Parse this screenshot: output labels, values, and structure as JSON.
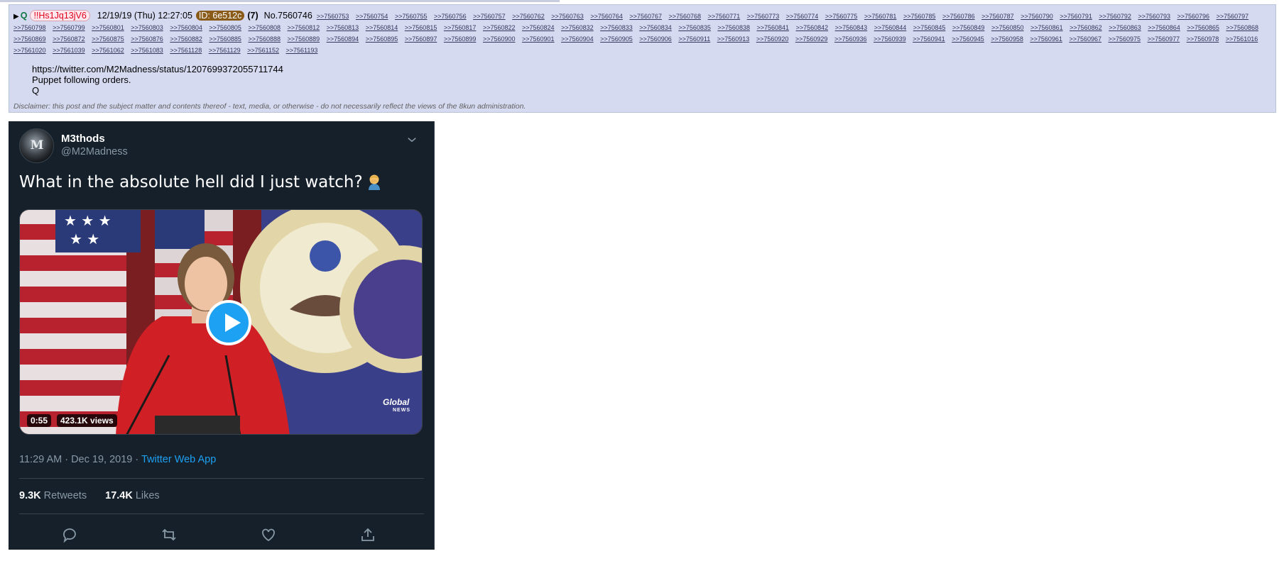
{
  "post": {
    "triangle": "▶",
    "name": "Q",
    "tripcode": "!!Hs1Jq13jV6",
    "datetime": "12/19/19 (Thu) 12:27:05",
    "id_badge": "ID: 6e512c",
    "id_count": "(7)",
    "post_number": "No.7560746",
    "replies": [
      ">>7560753",
      ">>7560754",
      ">>7560755",
      ">>7560756",
      ">>7560757",
      ">>7560762",
      ">>7560763",
      ">>7560764",
      ">>7560767",
      ">>7560768",
      ">>7560771",
      ">>7560773",
      ">>7560774",
      ">>7560775",
      ">>7560781",
      ">>7560785",
      ">>7560786",
      ">>7560787",
      ">>7560790",
      ">>7560791",
      ">>7560792",
      ">>7560793",
      ">>7560796",
      ">>7560797",
      ">>7560798",
      ">>7560799",
      ">>7560801",
      ">>7560803",
      ">>7560804",
      ">>7560805",
      ">>7560808",
      ">>7560812",
      ">>7560813",
      ">>7560814",
      ">>7560815",
      ">>7560817",
      ">>7560822",
      ">>7560824",
      ">>7560832",
      ">>7560833",
      ">>7560834",
      ">>7560835",
      ">>7560838",
      ">>7560841",
      ">>7560842",
      ">>7560843",
      ">>7560844",
      ">>7560845",
      ">>7560849",
      ">>7560850",
      ">>7560861",
      ">>7560862",
      ">>7560863",
      ">>7560864",
      ">>7560865",
      ">>7560868",
      ">>7560869",
      ">>7560872",
      ">>7560875",
      ">>7560876",
      ">>7560882",
      ">>7560885",
      ">>7560888",
      ">>7560889",
      ">>7560894",
      ">>7560895",
      ">>7560897",
      ">>7560899",
      ">>7560900",
      ">>7560901",
      ">>7560904",
      ">>7560905",
      ">>7560906",
      ">>7560911",
      ">>7560913",
      ">>7560920",
      ">>7560929",
      ">>7560936",
      ">>7560939",
      ">>7560941",
      ">>7560945",
      ">>7560958",
      ">>7560961",
      ">>7560967",
      ">>7560975",
      ">>7560977",
      ">>7560978",
      ">>7561016",
      ">>7561020",
      ">>7561039",
      ">>7561062",
      ">>7561083",
      ">>7561128",
      ">>7561129",
      ">>7561152",
      ">>7561193"
    ],
    "body_lines": [
      "https://twitter.com/M2Madness/status/1207699372055711744",
      "Puppet following orders.",
      "Q"
    ],
    "disclaimer": "Disclaimer: this post and the subject matter and contents thereof - text, media, or otherwise - do not necessarily reflect the views of the 8kun administration."
  },
  "tweet": {
    "display_name": "M3thods",
    "handle": "@M2Madness",
    "avatar_letters": "M",
    "text": "What in the absolute hell did I just watch?",
    "emoji": "man-facepalming",
    "media": {
      "duration": "0:55",
      "views": "423.1K views",
      "logo_main": "Global",
      "logo_sub": "NEWS"
    },
    "time_prefix": "11:29 AM · Dec 19, 2019 · ",
    "source": "Twitter Web App",
    "retweets_count": "9.3K",
    "retweets_label": "Retweets",
    "likes_count": "17.4K",
    "likes_label": "Likes",
    "action_icons": [
      "reply-icon",
      "retweet-icon",
      "like-icon",
      "share-icon"
    ]
  },
  "colors": {
    "post_background": "#d6daf0",
    "trip_red": "#e0001a",
    "id_badge": "#8a5a18",
    "tweet_background": "#15202b",
    "twitter_blue": "#1da1f2",
    "muted": "#8899a6"
  }
}
